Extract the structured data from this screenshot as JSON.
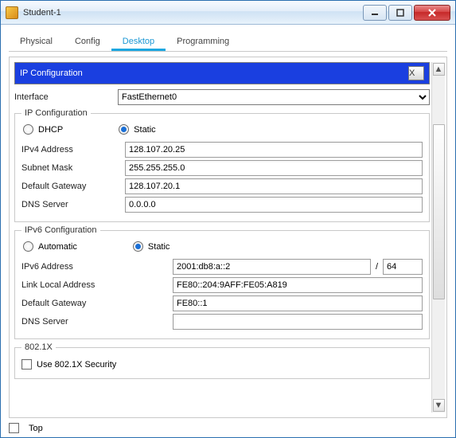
{
  "window": {
    "title": "Student-1"
  },
  "tabs": {
    "physical": "Physical",
    "config": "Config",
    "desktop": "Desktop",
    "programming": "Programming"
  },
  "dialog": {
    "title": "IP Configuration",
    "close": "X"
  },
  "interface": {
    "label": "Interface",
    "value": "FastEthernet0"
  },
  "ipv4": {
    "legend": "IP Configuration",
    "dhcp": "DHCP",
    "static": "Static",
    "addr_label": "IPv4 Address",
    "addr": "128.107.20.25",
    "mask_label": "Subnet Mask",
    "mask": "255.255.255.0",
    "gw_label": "Default Gateway",
    "gw": "128.107.20.1",
    "dns_label": "DNS Server",
    "dns": "0.0.0.0"
  },
  "ipv6": {
    "legend": "IPv6 Configuration",
    "auto": "Automatic",
    "static": "Static",
    "addr_label": "IPv6 Address",
    "addr": "2001:db8:a::2",
    "prefix_sep": "/",
    "prefix": "64",
    "ll_label": "Link Local Address",
    "ll": "FE80::204:9AFF:FE05:A819",
    "gw_label": "Default Gateway",
    "gw": "FE80::1",
    "dns_label": "DNS Server",
    "dns": ""
  },
  "dot1x": {
    "legend": "802.1X",
    "use": "Use 802.1X Security"
  },
  "footer": {
    "top": "Top"
  }
}
